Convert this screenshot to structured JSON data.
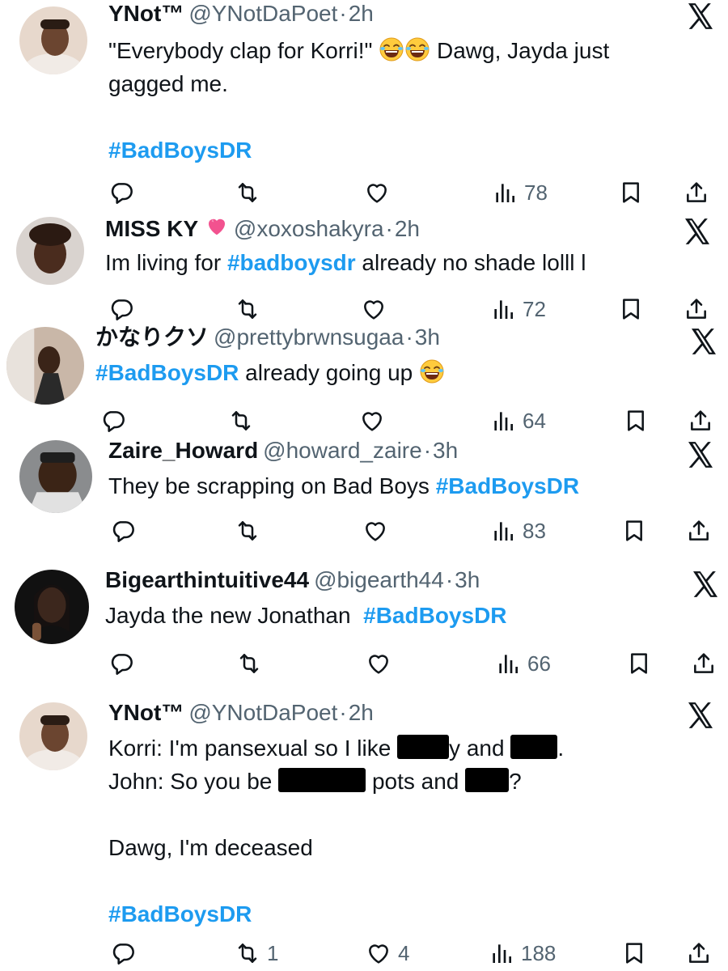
{
  "tweets": [
    {
      "name": "YNot™",
      "handle": "@YNotDaPoet",
      "time": "2h",
      "lines": [
        "\"Everybody clap for Korri!\"",
        "Dawg, Jayda just",
        "gagged me."
      ],
      "hashtag": "#BadBoysDR",
      "views": "78",
      "retweets": "",
      "likes": ""
    },
    {
      "name": "MISS KY",
      "handle": "@xoxoshakyra",
      "time": "2h",
      "text_before": "Im living for",
      "hashtag": "#badboysdr",
      "text_after": "already no shade lolll l",
      "views": "72"
    },
    {
      "name": "かなりクソ",
      "handle": "@prettybrwnsugaa",
      "time": "3h",
      "hashtag": "#BadBoysDR",
      "text_after": "already going up",
      "views": "64"
    },
    {
      "name": "Zaire_Howard",
      "handle": "@howard_zaire",
      "time": "3h",
      "text_before": "They be scrapping on Bad Boys",
      "hashtag": "#BadBoysDR",
      "views": "83"
    },
    {
      "name": "Bigearthintuitive44",
      "handle": "@bigearth44",
      "time": "3h",
      "text_before": "Jayda the new Jonathan",
      "hashtag": "#BadBoysDR",
      "views": "66"
    },
    {
      "name": "YNot™",
      "handle": "@YNotDaPoet",
      "time": "2h",
      "line1_a": "Korri: I'm pansexual so I like",
      "line1_b": "y and",
      "line1_c": ".",
      "line2_a": "John: So you be",
      "line2_b": "pots and",
      "line2_c": "?",
      "line3": "Dawg, I'm deceased",
      "hashtag": "#BadBoysDR",
      "retweets": "1",
      "likes": "4",
      "views": "188"
    }
  ],
  "separator": "·",
  "colors": {
    "accent": "#1d9bf0",
    "muted": "#536471",
    "text": "#0f1419"
  }
}
